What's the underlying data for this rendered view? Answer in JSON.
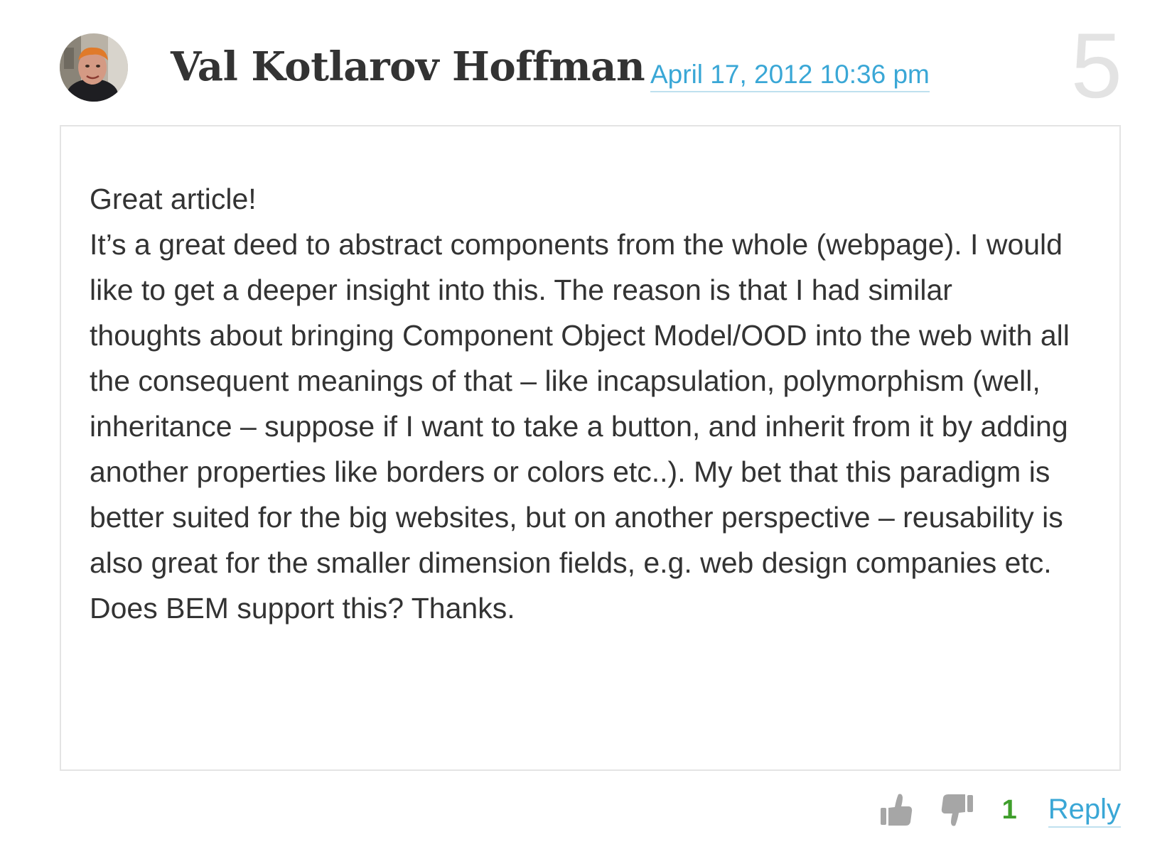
{
  "comment": {
    "author": "Val Kotlarov Hoffman",
    "date": "April 17, 2012 10:36 pm",
    "number": "5",
    "body_lines": [
      "Great article!",
      "It’s a great deed to abstract components from the whole (webpage). I would like to get a deeper insight into this. The reason is that I had similar thoughts about bringing Component Object Model/OOD into the web with all the consequent meanings of that – like incapsulation, polymorphism (well, inheritance – suppose if I want to take a button, and inherit from it by adding another properties like borders or colors etc..). My bet that this paradigm is better suited for the big websites, but on another perspective – reusability is also great for the smaller dimension fields, e.g. web design companies etc. Does BEM support this? Thanks."
    ],
    "votes": {
      "up_icon": "thumbs-up-icon",
      "down_icon": "thumbs-down-icon",
      "count": "1"
    },
    "reply_label": "Reply"
  },
  "colors": {
    "link": "#3aa7d6",
    "vote_count": "#3f9e2b",
    "text": "#333333",
    "number": "#e3e3e3",
    "border": "#e4e4e4"
  }
}
